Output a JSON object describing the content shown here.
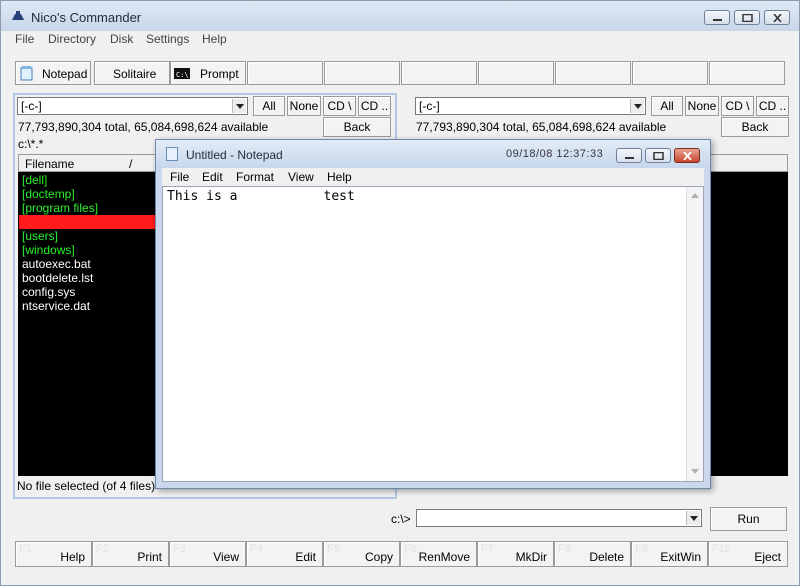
{
  "app": {
    "title": "Nico's Commander"
  },
  "menu": [
    "File",
    "Directory",
    "Disk",
    "Settings",
    "Help"
  ],
  "toolbar": [
    {
      "label": "Notepad",
      "icon": "notepad-icon"
    },
    {
      "label": "Solitaire",
      "icon": ""
    },
    {
      "label": "Prompt",
      "icon": "console-icon"
    }
  ],
  "left_panel": {
    "drive": "[-c-]",
    "buttons": {
      "all": "All",
      "none": "None",
      "cd_root": "CD \\",
      "cd_up": "CD ..",
      "back": "Back"
    },
    "space": "77,793,890,304 total, 65,084,698,624 available",
    "path": "c:\\*.*",
    "header": {
      "filename": "Filename",
      "sort": "/"
    },
    "items": [
      {
        "name": "[dell]",
        "type": "dir"
      },
      {
        "name": "[doctemp]",
        "type": "dir"
      },
      {
        "name": "[program files]",
        "type": "dir"
      },
      {
        "name": "[users]",
        "type": "dir"
      },
      {
        "name": "[windows]",
        "type": "dir"
      },
      {
        "name": "autoexec.bat",
        "type": "file"
      },
      {
        "name": "bootdelete.lst",
        "type": "file"
      },
      {
        "name": "config.sys",
        "type": "file"
      },
      {
        "name": "ntservice.dat",
        "type": "file"
      }
    ],
    "status": "No file selected (of 4 files)"
  },
  "right_panel": {
    "drive": "[-c-]",
    "buttons": {
      "all": "All",
      "none": "None",
      "cd_root": "CD \\",
      "cd_up": "CD ..",
      "back": "Back"
    },
    "space": "77,793,890,304 total, 65,084,698,624 available"
  },
  "command": {
    "label": "c:\\>",
    "run": "Run"
  },
  "fkeys": [
    {
      "num": "F1",
      "label": "Help"
    },
    {
      "num": "F2",
      "label": "Print"
    },
    {
      "num": "F3",
      "label": "View"
    },
    {
      "num": "F4",
      "label": "Edit"
    },
    {
      "num": "F5",
      "label": "Copy"
    },
    {
      "num": "F6",
      "label": "RenMove"
    },
    {
      "num": "F7",
      "label": "MkDir"
    },
    {
      "num": "F8",
      "label": "Delete"
    },
    {
      "num": "F9",
      "label": "ExitWin"
    },
    {
      "num": "F10",
      "label": "Eject"
    }
  ],
  "notepad": {
    "title": "Untitled - Notepad",
    "clock": "09/18/08  12:37:33",
    "menu": [
      "File",
      "Edit",
      "Format",
      "View",
      "Help"
    ],
    "content": "This is a           test"
  },
  "colors": {
    "dir": "#2cf02c",
    "selection": "#ff1b1b",
    "list_bg": "#000000",
    "panel_border": "#b0c8e6"
  }
}
